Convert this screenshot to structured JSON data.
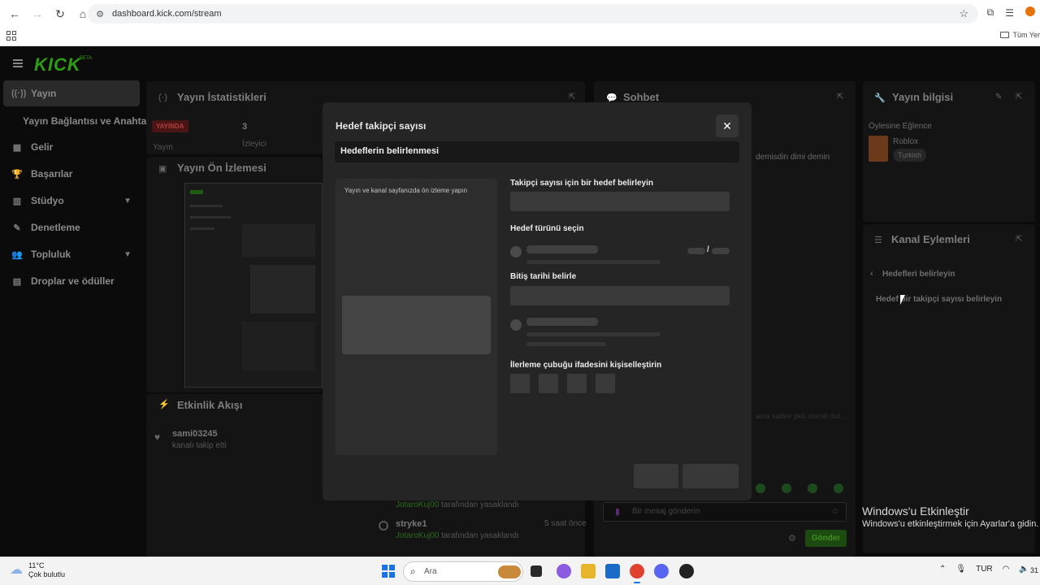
{
  "browser": {
    "url": "dashboard.kick.com/stream",
    "bookmarks_folder": "Tüm Yer"
  },
  "dashboard": {
    "logo": "KICK",
    "logo_sup": "BETA",
    "sidebar": {
      "items": [
        {
          "label": "Yayın",
          "icon": "broadcast-icon"
        },
        {
          "label": "Yayın Bağlantısı ve Anahtarı",
          "icon": ""
        },
        {
          "label": "Gelir",
          "icon": "revenue-icon"
        },
        {
          "label": "Başarılar",
          "icon": "trophy-icon"
        },
        {
          "label": "Stüdyo",
          "icon": "studio-icon"
        },
        {
          "label": "Denetleme",
          "icon": "moderation-icon"
        },
        {
          "label": "Topluluk",
          "icon": "community-icon"
        },
        {
          "label": "Droplar ve ödüller",
          "icon": "drops-icon"
        }
      ]
    },
    "stats": {
      "title": "Yayın İstatistikleri",
      "live_badge": "YAYINDA",
      "live_label": "Yayın",
      "viewers_count": "3",
      "viewers_label": "İzleyici"
    },
    "preview": {
      "title": "Yayın Ön İzlemesi"
    },
    "activity": {
      "title": "Etkinlik Akışı",
      "follow_user": "sami03245",
      "follow_text": "kanalı takip etti",
      "ban1_by": "JotaroKuj00",
      "ban1_text": "tarafından yasaklandı",
      "ban2_user": "stryke1",
      "ban2_time": "5 saat önce",
      "ban2_by": "JotaroKuj00",
      "ban2_text": "tarafından yasaklandı"
    },
    "chat": {
      "title": "Sohbet",
      "msg_fragment": "demisdin dimi demin",
      "slow_fragment": "ama sadee pek onmel dut...",
      "input_placeholder": "Bir mesaj gönderin",
      "send_label": "Gönder"
    },
    "stream_info": {
      "title": "Yayın bilgisi",
      "stream_title": "Öylesine Eğlence",
      "category": "Roblox",
      "language": "Turkish"
    },
    "channel_actions": {
      "title": "Kanal Eylemleri",
      "back_label": "Hedefleri belirleyin",
      "action_label": "Hedef bir takipçi sayısı belirleyin"
    }
  },
  "modal": {
    "title": "Hedef takipçi sayısı",
    "step_label": "Hedeflerin belirlenmesi",
    "preview_text": "Yayın ve kanal sayfanızda ön izleme yapın",
    "follower_goal_label": "Takipçi sayısı için bir hedef belirleyin",
    "goal_type_label": "Hedef türünü seçin",
    "end_date_label": "Bitiş tarihi belirle",
    "progress_label": "İlerleme çubuğu ifadesini kişiselleştirin",
    "slash": "/"
  },
  "windows_activation": {
    "title": "Windows'u Etkinleştir",
    "subtitle": "Windows'u etkinleştirmek için Ayarlar'a gidin."
  },
  "taskbar": {
    "temp": "11°C",
    "weather": "Çok bulutlu",
    "search_placeholder": "Ara",
    "lang": "TUR",
    "clock": "31"
  }
}
